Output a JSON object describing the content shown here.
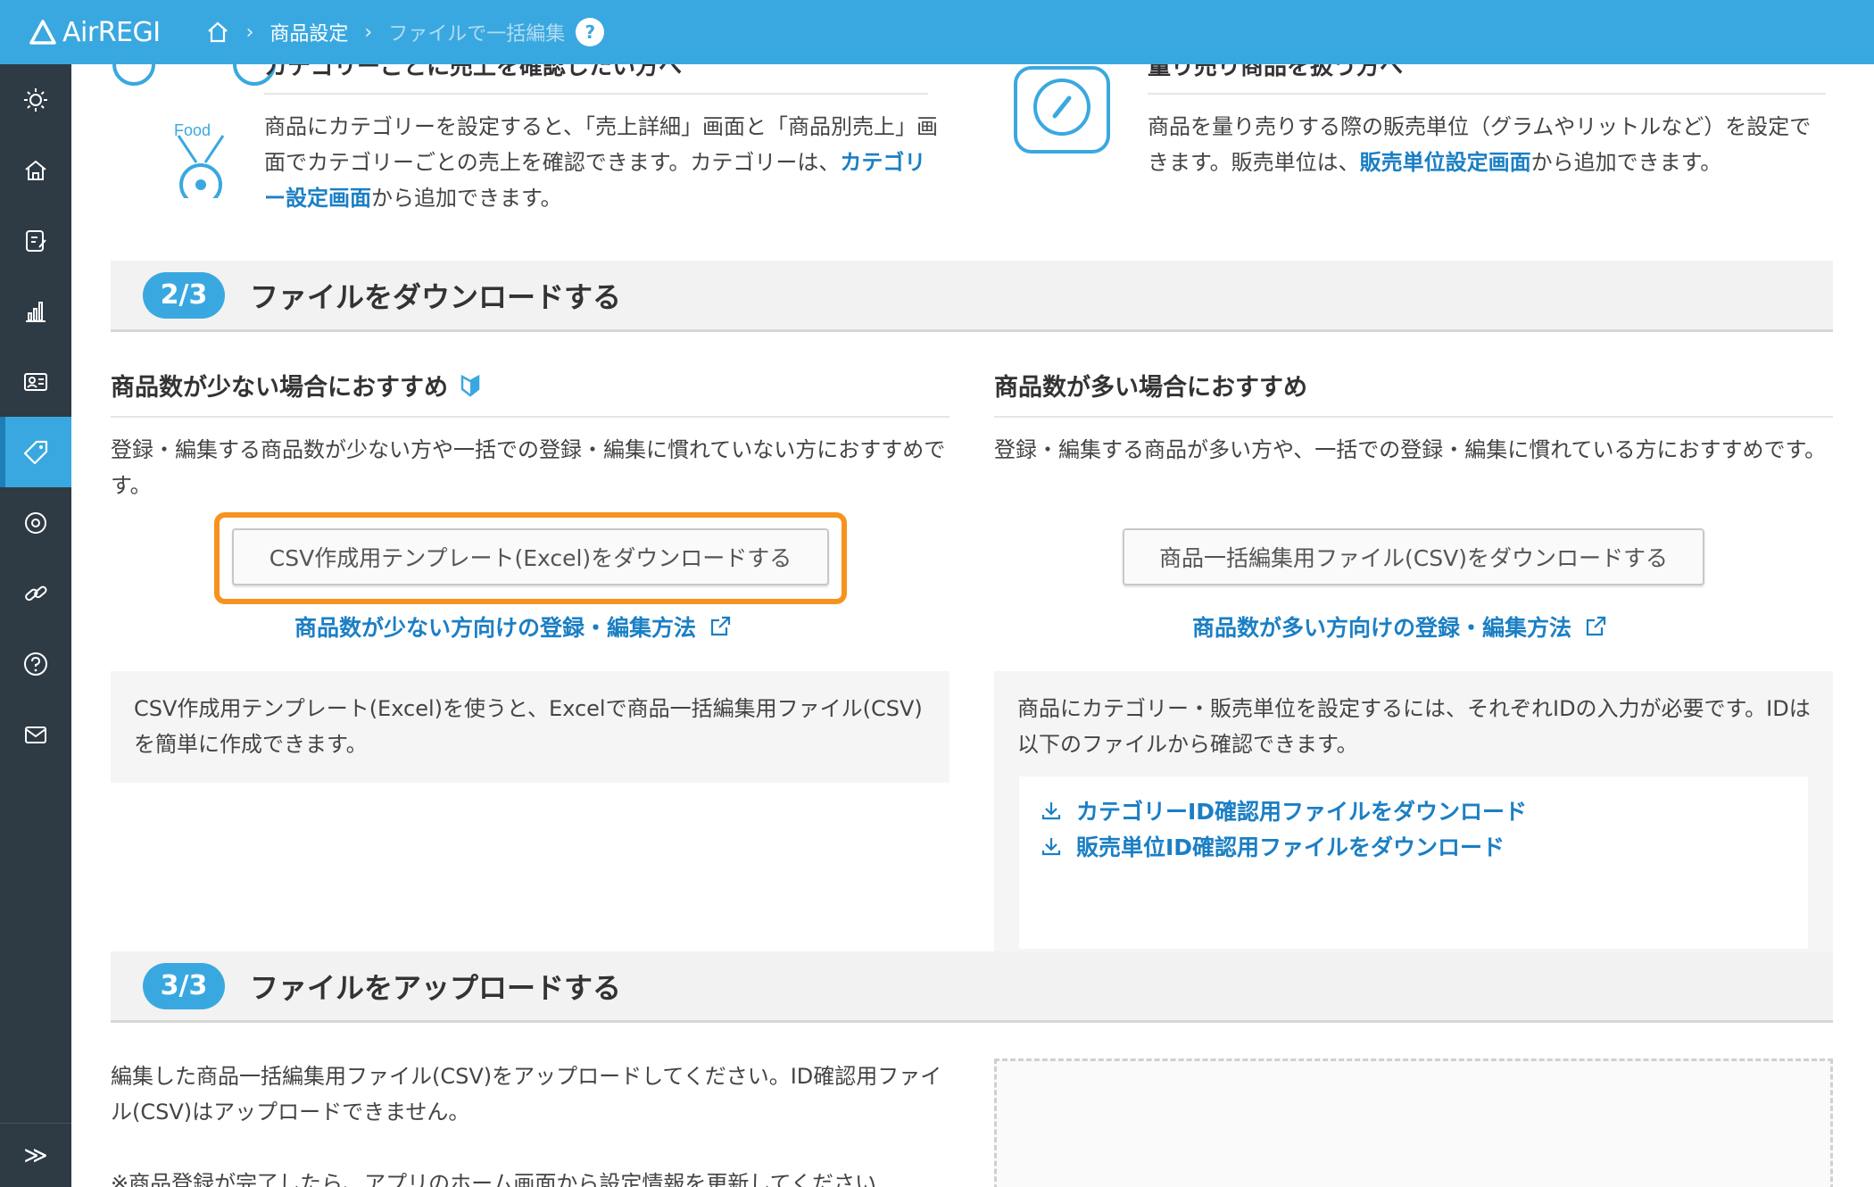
{
  "header": {
    "logo_text": "AirREGI",
    "breadcrumb": [
      "商品設定",
      "ファイルで一括編集"
    ],
    "help_label": "?"
  },
  "sidebar": {
    "items": [
      {
        "icon": "sun-icon"
      },
      {
        "icon": "home-icon"
      },
      {
        "icon": "register-icon"
      },
      {
        "icon": "chart-icon"
      },
      {
        "icon": "id-card-icon"
      },
      {
        "icon": "tag-icon",
        "active": true
      },
      {
        "icon": "settings-icon"
      },
      {
        "icon": "link-icon"
      },
      {
        "icon": "help-icon"
      },
      {
        "icon": "mail-icon"
      }
    ],
    "expand_label": "≫"
  },
  "features": {
    "category": {
      "title": "カテゴリーごとに売上を確認したい方へ",
      "icon_label": "Food",
      "text_before": "商品にカテゴリーを設定すると、「売上詳細」画面と「商品別売上」画面でカテゴリーごとの売上を確認できます。カテゴリーは、",
      "link": "カテゴリー設定画面",
      "text_after": "から追加できます。"
    },
    "unit": {
      "title": "量り売り商品を扱う方へ",
      "text_before": "商品を量り売りする際の販売単位（グラムやリットルなど）を設定できます。販売単位は、",
      "link": "販売単位設定画面",
      "text_after": "から追加できます。"
    }
  },
  "step2": {
    "badge": "2/3",
    "title": "ファイルをダウンロードする",
    "few": {
      "title": "商品数が少ない場合におすすめ",
      "desc": "登録・編集する商品数が少ない方や一括での登録・編集に慣れていない方におすすめです。",
      "button": "CSV作成用テンプレート(Excel)をダウンロードする",
      "link": "商品数が少ない方向けの登録・編集方法",
      "note": "CSV作成用テンプレート(Excel)を使うと、Excelで商品一括編集用ファイル(CSV)を簡単に作成できます。"
    },
    "many": {
      "title": "商品数が多い場合におすすめ",
      "desc": "登録・編集する商品が多い方や、一括での登録・編集に慣れている方におすすめです。",
      "button": "商品一括編集用ファイル(CSV)をダウンロードする",
      "link": "商品数が多い方向けの登録・編集方法",
      "note": "商品にカテゴリー・販売単位を設定するには、それぞれIDの入力が必要です。IDは以下のファイルから確認できます。",
      "files": [
        "カテゴリーID確認用ファイルをダウンロード",
        "販売単位ID確認用ファイルをダウンロード"
      ]
    }
  },
  "step3": {
    "badge": "3/3",
    "title": "ファイルをアップロードする",
    "desc": "編集した商品一括編集用ファイル(CSV)をアップロードしてください。ID確認用ファイル(CSV)はアップロードできません。",
    "note": "※商品登録が完了したら、アプリのホーム画面から設定情報を更新してください"
  },
  "colors": {
    "accent": "#3aa8e0",
    "sidebar": "#2e3a44",
    "link": "#1b7fc4",
    "highlight": "#f6931e"
  }
}
